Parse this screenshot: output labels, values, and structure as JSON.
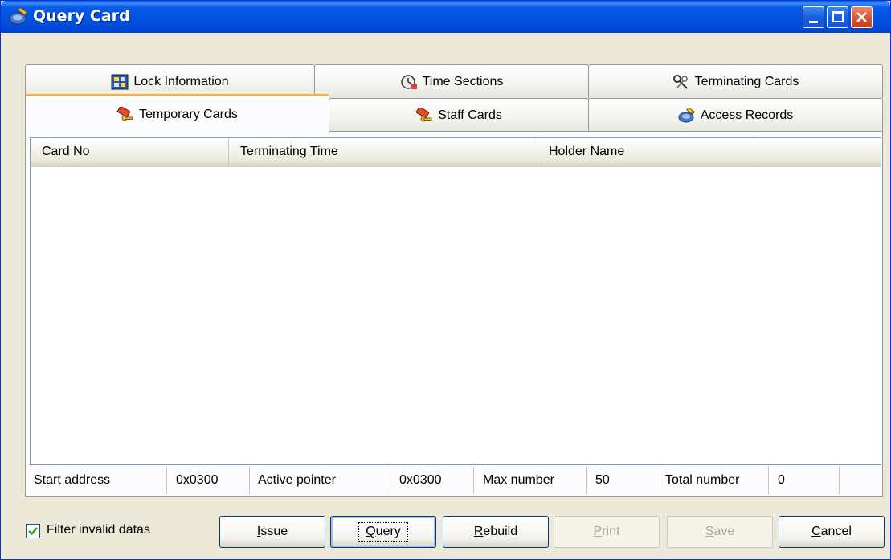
{
  "window": {
    "title": "Query Card",
    "title_icon": "card-edit-icon"
  },
  "tabs_row1": [
    {
      "label": "Lock Information",
      "icon": "lock-info-icon"
    },
    {
      "label": "Time Sections",
      "icon": "time-sections-icon"
    },
    {
      "label": "Terminating Cards",
      "icon": "terminating-cards-icon"
    }
  ],
  "tabs_row2": [
    {
      "label": "Temporary Cards",
      "icon": "temporary-card-icon",
      "active": true
    },
    {
      "label": "Staff Cards",
      "icon": "staff-card-icon"
    },
    {
      "label": "Access Records",
      "icon": "access-records-icon"
    }
  ],
  "table": {
    "columns": [
      "Card No",
      "Terminating Time",
      "Holder Name"
    ],
    "rows": []
  },
  "info": {
    "start_address_label": "Start address",
    "start_address_value": "0x0300",
    "active_pointer_label": "Active pointer",
    "active_pointer_value": "0x0300",
    "max_number_label": "Max number",
    "max_number_value": "50",
    "total_number_label": "Total number",
    "total_number_value": "0"
  },
  "filter": {
    "label": "Filter invalid datas",
    "checked": true
  },
  "buttons": {
    "issue": {
      "mnemonic": "I",
      "rest": "ssue"
    },
    "query": {
      "mnemonic": "Q",
      "rest": "uery"
    },
    "rebuild": {
      "mnemonic": "R",
      "rest": "ebuild"
    },
    "print": {
      "mnemonic": "P",
      "rest": "rint"
    },
    "save": {
      "mnemonic": "S",
      "rest": "ave"
    },
    "cancel": {
      "mnemonic": "C",
      "rest": "ancel"
    }
  },
  "colors": {
    "titlebar": "#0051e0",
    "active_tab_accent": "#f6b33c",
    "dialog_bg": "#ece9d8"
  }
}
